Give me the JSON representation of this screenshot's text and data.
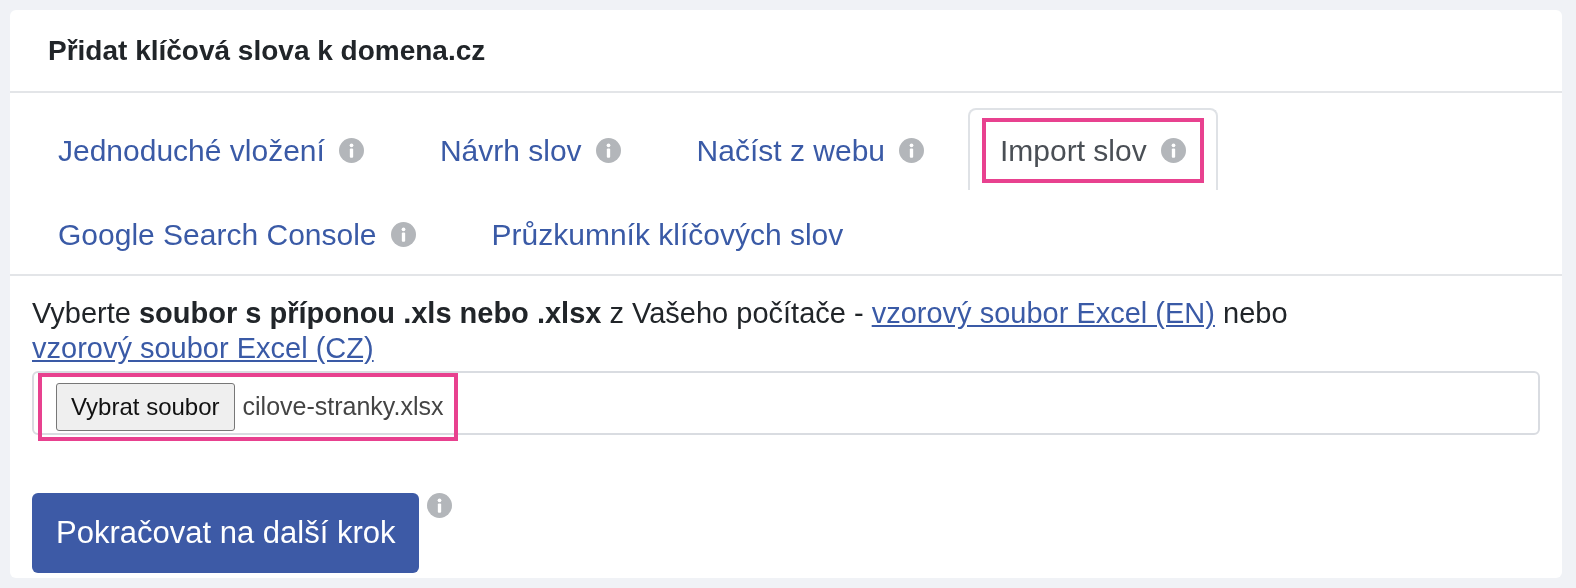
{
  "card": {
    "title": "Přidat klíčová slova k domena.cz"
  },
  "tabs": [
    {
      "label": "Jednoduché vložení",
      "info": true,
      "selected": false,
      "highlighted": false
    },
    {
      "label": "Návrh slov",
      "info": true,
      "selected": false,
      "highlighted": false
    },
    {
      "label": "Načíst z webu",
      "info": true,
      "selected": false,
      "highlighted": false
    },
    {
      "label": "Import slov",
      "info": true,
      "selected": true,
      "highlighted": true
    },
    {
      "label": "Google Search Console",
      "info": true,
      "selected": false,
      "highlighted": false
    },
    {
      "label": "Průzkumník klíčových slov",
      "info": false,
      "selected": false,
      "highlighted": false
    }
  ],
  "instruction": [
    {
      "kind": "text",
      "text": "Vyberte **soubor s příponou .xls nebo .xlsx** z Vašeho počítače - "
    },
    {
      "kind": "link",
      "text": "vzorový soubor Excel (EN)"
    },
    {
      "kind": "text",
      "text": " nebo "
    },
    {
      "kind": "link",
      "text": "vzorový soubor Excel (CZ)"
    }
  ],
  "file_input": {
    "button": "Vybrat soubor",
    "value": "cilove-stranky.xlsx",
    "highlighted": true
  },
  "submit": {
    "label": "Pokračovat na další krok",
    "info": true
  }
}
